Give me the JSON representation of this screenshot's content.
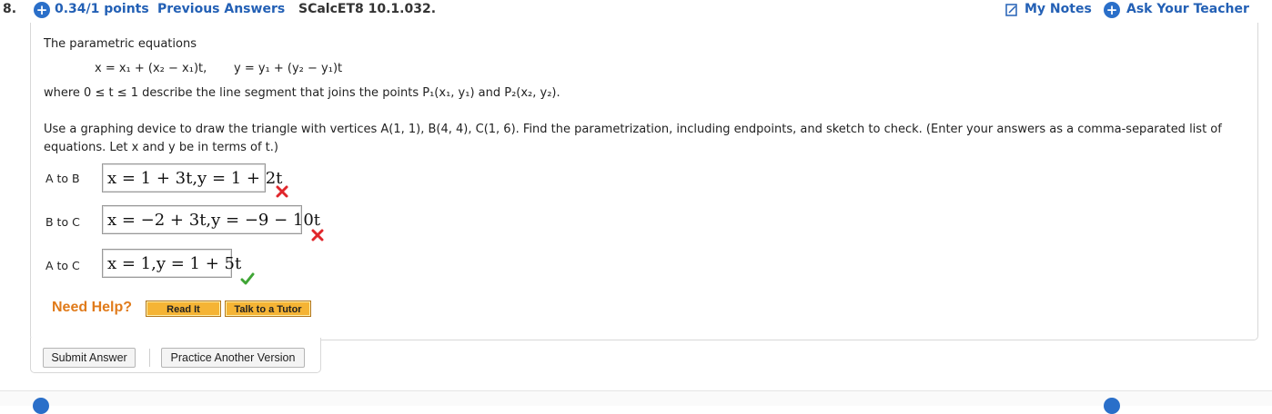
{
  "header": {
    "question_number": "8.",
    "points": "0.34/1 points",
    "previous_answers": "Previous Answers",
    "question_id": "SCalcET8 10.1.032.",
    "my_notes": "My Notes",
    "ask_teacher": "Ask Your Teacher"
  },
  "problem": {
    "intro": "The parametric equations",
    "equation_x": "x = x₁ + (x₂ − x₁)t,",
    "equation_y": "y = y₁ + (y₂ − y₁)t",
    "where_line": "where  0 ≤ t ≤ 1  describe the line segment that joins the points  P₁(x₁, y₁)  and  P₂(x₂, y₂).",
    "instructions_line1": "Use a graphing device to draw the triangle with vertices A(1, 1), B(4, 4), C(1, 6). Find the parametrization, including endpoints, and sketch to check. (Enter your answers as a comma-separated list of",
    "instructions_line2": "equations. Let x and y be in terms of t.)"
  },
  "answers": [
    {
      "label": "A to B",
      "value": "x = 1 + 3t,y = 1 + 2t",
      "status": "incorrect"
    },
    {
      "label": "B to C",
      "value": "x = −2 + 3t,y = −9 − 10t",
      "status": "incorrect"
    },
    {
      "label": "A to C",
      "value": "x = 1,y = 1 + 5t",
      "status": "correct"
    }
  ],
  "help": {
    "title": "Need Help?",
    "read_it": "Read It",
    "talk_to_tutor": "Talk to a Tutor"
  },
  "buttons": {
    "submit": "Submit Answer",
    "practice": "Practice Another Version"
  },
  "colors": {
    "link_blue": "#2360b5",
    "incorrect_red": "#e0262b",
    "correct_green": "#3fa535",
    "help_orange": "#e07b1b"
  }
}
